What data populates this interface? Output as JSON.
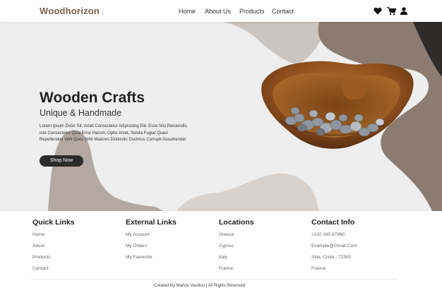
{
  "brand": {
    "name": "Woodhorizon",
    "dot": "."
  },
  "nav": {
    "items": [
      "Home",
      "About Us",
      "Products",
      "Contact"
    ]
  },
  "icons": {
    "heart": "heart-icon",
    "cart": "cart-icon",
    "user": "user-icon"
  },
  "hero": {
    "title": "Wooden Crafts",
    "subtitle": "Unique & Handmade",
    "text": "Lorem Ipsum Dolor Sit, Amet Consectetur Adipisicing Elit. Esse Nisi Reiciendis, Iste Consectetur Quia Error Harum, Optio Amet, Soluta Fugiat Quasi Repellendus Velit Quos Nihil Maiores Distinctio Ducimus Corrupti Assumenda!",
    "button": "Shop Now"
  },
  "footer": {
    "quick": {
      "title": "Quick Links",
      "items": [
        "Home",
        "About",
        "Products",
        "Contact"
      ]
    },
    "external": {
      "title": "External Links",
      "items": [
        "My Account",
        "My Orders",
        "My Favourite"
      ]
    },
    "locations": {
      "title": "Locations",
      "items": [
        "Greece",
        "Cyprus",
        "Italy",
        "France"
      ]
    },
    "contact": {
      "title": "Contact Info",
      "items": [
        "+210 345 67890",
        "Example@Gmail.Com",
        "Sitia, Creta - 72300",
        "France"
      ]
    },
    "copyright": "Created By Marios Vasiliou | All Rights Reserved"
  },
  "colors": {
    "brand": "#7a6150",
    "accent_shape": "#8c7b70",
    "light_shape": "#d6cdc7",
    "button": "#2c2b2b"
  }
}
